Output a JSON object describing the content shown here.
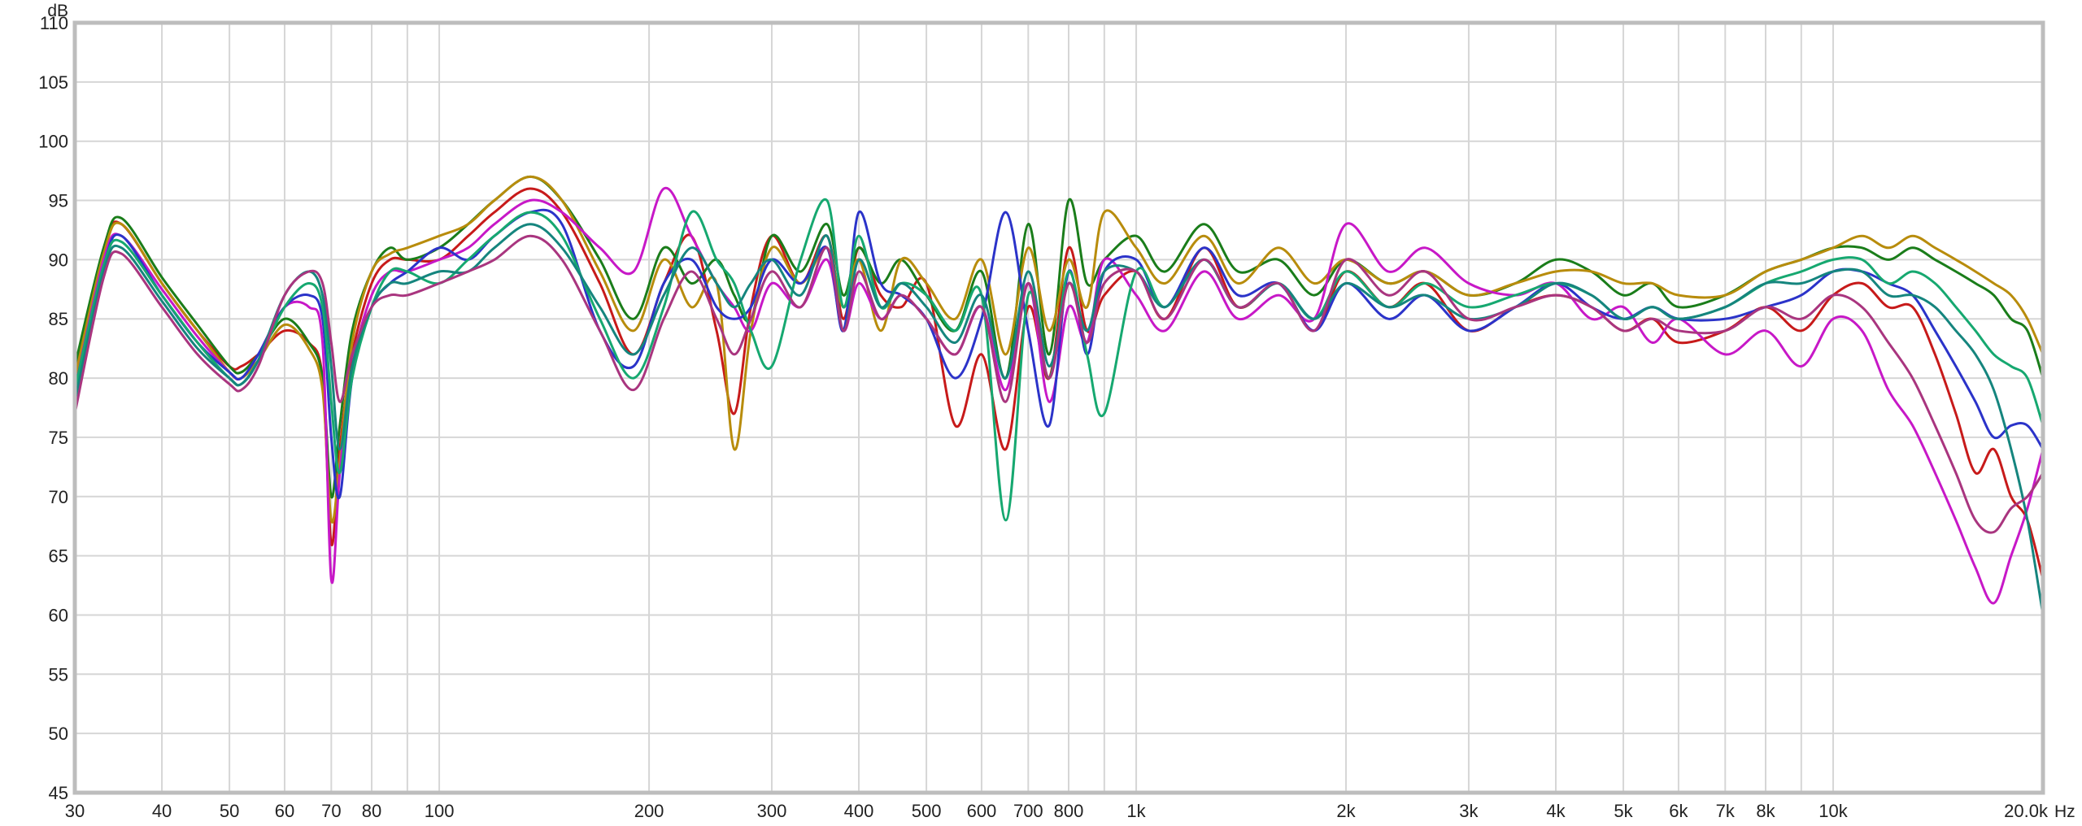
{
  "chart_data": {
    "type": "line",
    "title": "",
    "xlabel": "",
    "ylabel": "",
    "x_unit": "Hz",
    "y_unit": "dB",
    "x_scale": "log",
    "xlim": [
      30,
      20000
    ],
    "ylim": [
      45,
      110
    ],
    "grid": true,
    "legend": "none",
    "x_ticks": [
      {
        "value": 30,
        "label": "30"
      },
      {
        "value": 40,
        "label": "40"
      },
      {
        "value": 50,
        "label": "50"
      },
      {
        "value": 60,
        "label": "60"
      },
      {
        "value": 70,
        "label": "70"
      },
      {
        "value": 80,
        "label": "80"
      },
      {
        "value": 100,
        "label": "100"
      },
      {
        "value": 200,
        "label": "200"
      },
      {
        "value": 300,
        "label": "300"
      },
      {
        "value": 400,
        "label": "400"
      },
      {
        "value": 500,
        "label": "500"
      },
      {
        "value": 600,
        "label": "600"
      },
      {
        "value": 700,
        "label": "700"
      },
      {
        "value": 800,
        "label": "800"
      },
      {
        "value": 1000,
        "label": "1k"
      },
      {
        "value": 2000,
        "label": "2k"
      },
      {
        "value": 3000,
        "label": "3k"
      },
      {
        "value": 4000,
        "label": "4k"
      },
      {
        "value": 5000,
        "label": "5k"
      },
      {
        "value": 6000,
        "label": "6k"
      },
      {
        "value": 7000,
        "label": "7k"
      },
      {
        "value": 8000,
        "label": "8k"
      },
      {
        "value": 10000,
        "label": "10k"
      },
      {
        "value": 20000,
        "label": "20.0k"
      }
    ],
    "x_minor_gridlines": [
      90,
      900,
      9000
    ],
    "y_ticks": [
      45,
      50,
      55,
      60,
      65,
      70,
      75,
      80,
      85,
      90,
      95,
      100,
      105,
      110
    ],
    "x": [
      30,
      33,
      35,
      40,
      45,
      50,
      52,
      55,
      60,
      65,
      68,
      70,
      72,
      75,
      80,
      85,
      90,
      100,
      110,
      120,
      135,
      150,
      170,
      190,
      210,
      230,
      250,
      265,
      280,
      300,
      330,
      360,
      380,
      400,
      430,
      460,
      500,
      550,
      600,
      650,
      700,
      750,
      800,
      850,
      900,
      1000,
      1100,
      1250,
      1400,
      1600,
      1800,
      2000,
      2300,
      2600,
      3000,
      3500,
      4000,
      4500,
      5000,
      5500,
      6000,
      7000,
      8000,
      9000,
      10000,
      11000,
      12000,
      13000,
      14000,
      15000,
      16000,
      17000,
      18000,
      19000,
      20000
    ],
    "series": [
      {
        "color": "#c71a1a",
        "values": [
          80,
          91,
          93,
          88,
          84,
          81,
          81,
          82,
          84,
          83,
          80,
          66,
          74,
          82,
          88,
          90,
          90,
          90,
          92,
          94,
          96,
          94,
          88,
          82,
          88,
          92,
          84,
          77,
          86,
          92,
          88,
          92,
          85,
          91,
          87,
          86,
          88,
          76,
          82,
          74,
          86,
          80,
          91,
          84,
          87,
          89,
          85,
          91,
          86,
          88,
          84,
          89,
          86,
          88,
          84,
          86,
          87,
          86,
          84,
          85,
          83,
          84,
          86,
          84,
          87,
          88,
          86,
          86,
          82,
          77,
          72,
          74,
          70,
          68,
          63
        ]
      },
      {
        "color": "#1a7d1a",
        "values": [
          81,
          91,
          93.5,
          88.5,
          84.5,
          81,
          80.5,
          82,
          85,
          83,
          80,
          70,
          76,
          84,
          89,
          91,
          90,
          91,
          93,
          95,
          97,
          95,
          90,
          85,
          91,
          88,
          90,
          87,
          85,
          92,
          89,
          93,
          87,
          91,
          88,
          90,
          87,
          84,
          89,
          80,
          93,
          82,
          95,
          88,
          90,
          92,
          89,
          93,
          89,
          90,
          87,
          90,
          88,
          89,
          87,
          88,
          90,
          89,
          87,
          88,
          86,
          87,
          89,
          90,
          91,
          91,
          90,
          91,
          90,
          89,
          88,
          87,
          85,
          84,
          80
        ]
      },
      {
        "color": "#b88c0c",
        "values": [
          80,
          90.5,
          93,
          88,
          84,
          80.5,
          80,
          81.5,
          84.5,
          82.5,
          79,
          68,
          73,
          83,
          89,
          90.5,
          91,
          92,
          93,
          95,
          97,
          95,
          89,
          84,
          90,
          86,
          88,
          74,
          84,
          91,
          88,
          91,
          86,
          90,
          84,
          90,
          88,
          85,
          90,
          82,
          91,
          84,
          90,
          86,
          94,
          91,
          88,
          92,
          88,
          91,
          88,
          90,
          88,
          89,
          87,
          88,
          89,
          89,
          88,
          88,
          87,
          87,
          89,
          90,
          91,
          92,
          91,
          92,
          91,
          90,
          89,
          88,
          87,
          85,
          82
        ]
      },
      {
        "color": "#c718c7",
        "values": [
          79,
          90,
          92,
          87.5,
          83.5,
          80.5,
          80,
          82,
          86,
          86,
          83,
          63,
          72,
          81,
          87,
          89,
          89,
          90,
          91,
          93,
          95,
          94,
          91,
          89,
          96,
          92,
          88,
          86,
          84,
          88,
          86,
          90,
          84,
          88,
          85,
          87,
          85,
          82,
          86,
          79,
          88,
          78,
          86,
          83,
          90,
          87,
          84,
          89,
          85,
          87,
          85,
          93,
          89,
          91,
          88,
          87,
          88,
          85,
          86,
          83,
          85,
          82,
          84,
          81,
          85,
          84,
          79,
          76,
          72,
          68,
          64,
          61,
          65,
          69,
          74
        ]
      },
      {
        "color": "#2b33c9",
        "values": [
          79,
          89.5,
          92,
          87,
          83,
          80.5,
          80,
          82,
          86,
          87,
          85,
          75,
          70,
          80,
          86,
          88,
          89,
          91,
          90,
          92,
          94,
          93,
          84,
          81,
          88,
          90,
          86,
          85,
          86,
          90,
          88,
          91,
          84,
          94,
          88,
          87,
          85,
          80,
          85,
          94,
          84,
          76,
          89,
          82,
          89,
          90,
          86,
          91,
          87,
          88,
          84,
          88,
          85,
          87,
          84,
          86,
          88,
          86,
          85,
          86,
          85,
          85,
          86,
          87,
          89,
          89,
          88,
          87,
          84,
          81,
          78,
          75,
          76,
          76,
          74
        ]
      },
      {
        "color": "#16a870",
        "values": [
          79,
          89.5,
          91.5,
          87,
          83,
          80,
          79.5,
          81.5,
          86,
          88,
          86,
          78,
          72,
          80,
          86,
          89,
          89,
          88,
          90,
          92,
          94,
          92,
          85,
          80,
          86,
          94,
          90,
          88,
          84,
          81,
          90,
          95,
          86,
          92,
          86,
          88,
          87,
          84,
          87,
          68,
          87,
          80,
          89,
          82,
          77,
          89,
          86,
          90,
          86,
          88,
          85,
          89,
          86,
          88,
          86,
          87,
          88,
          87,
          85,
          86,
          85,
          86,
          88,
          89,
          90,
          90,
          88,
          89,
          88,
          86,
          84,
          82,
          81,
          80,
          76
        ]
      },
      {
        "color": "#15857e",
        "values": [
          78,
          89,
          91,
          86.5,
          82.5,
          80,
          79.5,
          81.5,
          87,
          89,
          87,
          81,
          74,
          81,
          86,
          88,
          88,
          89,
          89,
          91,
          93,
          91,
          86,
          82,
          87,
          91,
          88,
          86,
          88,
          90,
          87,
          92,
          84,
          90,
          86,
          88,
          86,
          83,
          87,
          80,
          89,
          81,
          88,
          84,
          89,
          89,
          86,
          90,
          86,
          88,
          85,
          88,
          86,
          87,
          85,
          86,
          88,
          87,
          85,
          86,
          85,
          86,
          88,
          88,
          89,
          89,
          87,
          87,
          86,
          84,
          82,
          79,
          74,
          68,
          60
        ]
      },
      {
        "color": "#a9357f",
        "values": [
          77,
          88.5,
          90.5,
          86,
          82,
          79.5,
          79,
          81,
          87,
          89,
          88,
          83,
          78,
          82,
          86,
          87,
          87,
          88,
          89,
          90,
          92,
          90,
          84,
          79,
          85,
          89,
          85,
          82,
          85,
          89,
          86,
          91,
          84,
          89,
          85,
          87,
          85,
          82,
          86,
          78,
          88,
          80,
          88,
          83,
          88,
          89,
          85,
          90,
          86,
          88,
          84,
          90,
          87,
          89,
          85,
          86,
          87,
          86,
          84,
          85,
          84,
          84,
          86,
          85,
          87,
          86,
          83,
          80,
          76,
          72,
          68,
          67,
          69,
          70,
          72
        ]
      }
    ]
  }
}
